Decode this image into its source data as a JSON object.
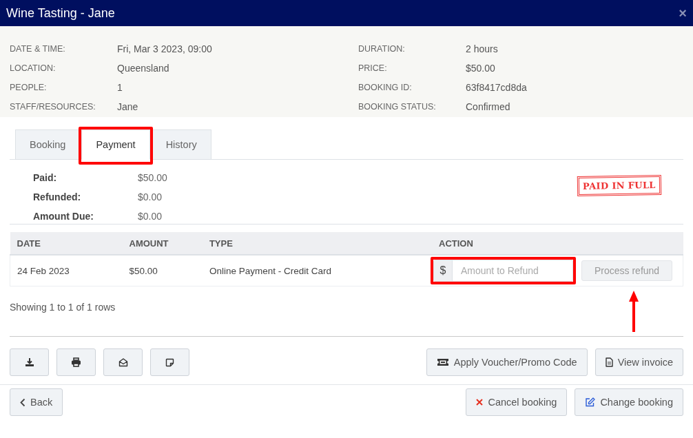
{
  "window": {
    "title": "Wine Tasting - Jane",
    "close": "×"
  },
  "details": {
    "left": [
      {
        "label": "DATE & TIME:",
        "value": "Fri, Mar 3 2023, 09:00"
      },
      {
        "label": "LOCATION:",
        "value": "Queensland"
      },
      {
        "label": "PEOPLE:",
        "value": "1"
      },
      {
        "label": "STAFF/RESOURCES:",
        "value": "Jane"
      }
    ],
    "right": [
      {
        "label": "DURATION:",
        "value": "2 hours"
      },
      {
        "label": "PRICE:",
        "value": "$50.00"
      },
      {
        "label": "BOOKING ID:",
        "value": "63f8417cd8da"
      },
      {
        "label": "BOOKING STATUS:",
        "value": "Confirmed"
      }
    ]
  },
  "tabs": [
    {
      "label": "Booking",
      "selected": false,
      "highlighted": false
    },
    {
      "label": "Payment",
      "selected": true,
      "highlighted": true
    },
    {
      "label": "History",
      "selected": false,
      "highlighted": false
    }
  ],
  "summary": [
    {
      "label": "Paid:",
      "value": "$50.00"
    },
    {
      "label": "Refunded:",
      "value": "$0.00"
    },
    {
      "label": "Amount Due:",
      "value": "$0.00"
    }
  ],
  "stamp": "PAID IN FULL",
  "table": {
    "columns": [
      "DATE",
      "AMOUNT",
      "TYPE",
      "ACTION"
    ],
    "rows": [
      {
        "date": "24 Feb 2023",
        "amount": "$50.00",
        "type": "Online Payment - Credit Card",
        "refund_prefix": "$",
        "refund_placeholder": "Amount to Refund",
        "refund_highlighted": true,
        "button": "Process refund",
        "button_disabled": true,
        "arrow": true
      }
    ]
  },
  "footer_text": "Showing 1 to 1 of 1 rows",
  "icon_buttons": [
    {
      "kind": "download"
    },
    {
      "kind": "print"
    },
    {
      "kind": "email"
    },
    {
      "kind": "note"
    }
  ],
  "action_buttons": [
    {
      "kind": "voucher",
      "label": "Apply Voucher/Promo Code"
    },
    {
      "kind": "invoice",
      "label": "View invoice"
    }
  ],
  "bottom_left": [
    {
      "kind": "back",
      "label": "Back"
    }
  ],
  "bottom_right": [
    {
      "kind": "cancel",
      "label": "Cancel booking"
    },
    {
      "kind": "edit",
      "label": "Change booking"
    }
  ]
}
